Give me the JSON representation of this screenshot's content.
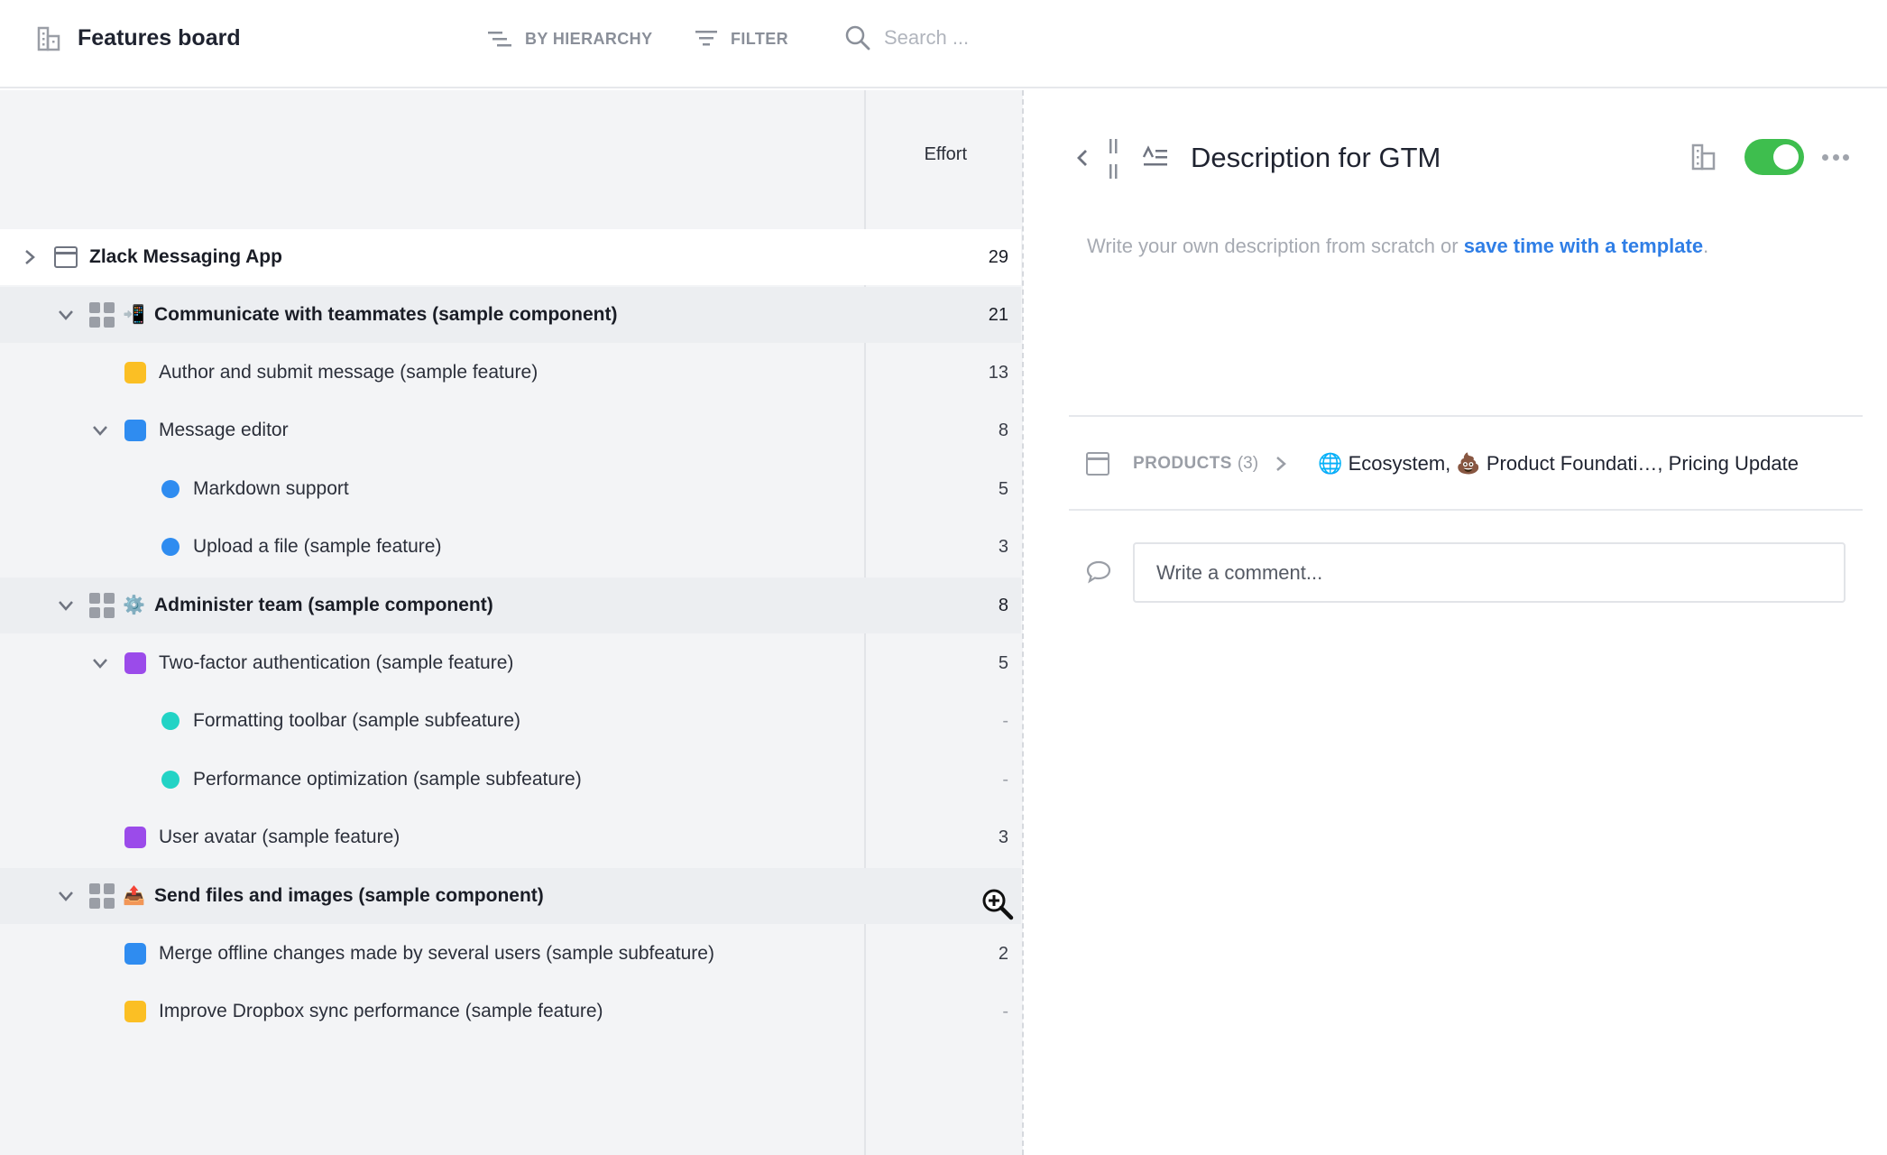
{
  "header": {
    "title": "Features board",
    "hierarchy_label": "BY HIERARCHY",
    "filter_label": "FILTER",
    "search_placeholder": "Search ..."
  },
  "table": {
    "effort_header": "Effort",
    "rows": [
      {
        "label": "Zlack Messaging App",
        "effort": "29"
      },
      {
        "label": "Communicate with teammates (sample component)",
        "effort": "21",
        "emoji": "📲"
      },
      {
        "label": "Author and submit message (sample feature)",
        "effort": "13"
      },
      {
        "label": "Message editor",
        "effort": "8"
      },
      {
        "label": "Markdown support",
        "effort": "5"
      },
      {
        "label": "Upload a file (sample feature)",
        "effort": "3"
      },
      {
        "label": "Administer team (sample component)",
        "effort": "8",
        "emoji": "⚙️"
      },
      {
        "label": "Two-factor authentication (sample feature)",
        "effort": "5"
      },
      {
        "label": "Formatting toolbar (sample subfeature)",
        "effort": "-"
      },
      {
        "label": "Performance optimization (sample subfeature)",
        "effort": "-"
      },
      {
        "label": "User avatar (sample feature)",
        "effort": "3"
      },
      {
        "label": "Send files and images (sample component)",
        "effort": "",
        "emoji": "📤"
      },
      {
        "label": "Merge offline changes made by several users (sample subfeature)",
        "effort": "2"
      },
      {
        "label": "Improve Dropbox sync performance (sample feature)",
        "effort": "-"
      }
    ]
  },
  "colors": {
    "yellow": "#fbbf24",
    "blue": "#2f8cf0",
    "purple": "#9b4bea",
    "teal": "#22d3c5",
    "toggle_on": "#3ebe4e",
    "link": "#2f7ee6"
  },
  "panel": {
    "title": "Description for GTM",
    "description_prompt": "Write your own description from scratch or ",
    "template_link": "save time with a template",
    "template_period": ".",
    "products_label": "PRODUCTS",
    "products_count": "(3)",
    "products_values": "🌐 Ecosystem, 💩 Product Foundati…, Pricing Update",
    "comment_placeholder": "Write a comment...",
    "toggle_on": true
  },
  "icons": {
    "board": "org-chart-icon",
    "hierarchy": "hierarchy-icon",
    "filter": "filter-icon",
    "search": "search-icon",
    "back": "chevron-left-icon",
    "drag": "drag-handle-icon",
    "description": "description-icon",
    "more": "more-horizontal-icon",
    "comment": "speech-bubble-icon",
    "cursor": "zoom-in-cursor-icon"
  }
}
